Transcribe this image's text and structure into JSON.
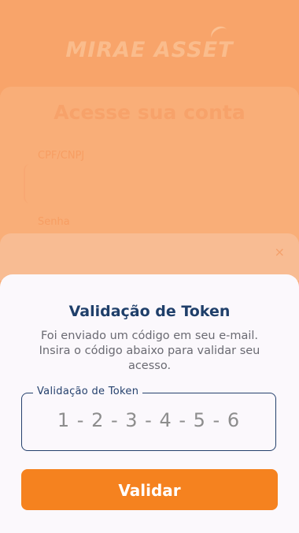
{
  "background": {
    "brand_name": "MIRAE ASSET",
    "brand_tagline": "",
    "login_title": "Acesse sua conta",
    "cpf_label": "CPF/CNPJ",
    "password_label": "Senha",
    "close_symbol": "×"
  },
  "modal": {
    "title": "Validação de Token",
    "description": "Foi enviado um código em seu e-mail. Insira o código abaixo para validar seu acesso.",
    "token_field": {
      "label": "Validação de Token",
      "placeholder": "1 - 2 - 3 - 4 - 5 - 6",
      "value": ""
    },
    "validate_label": "Validar"
  },
  "colors": {
    "accent": "#f5821f",
    "title": "#1f3f6a",
    "backdrop": "#f8a46a",
    "sheet": "#fbf8fc"
  }
}
